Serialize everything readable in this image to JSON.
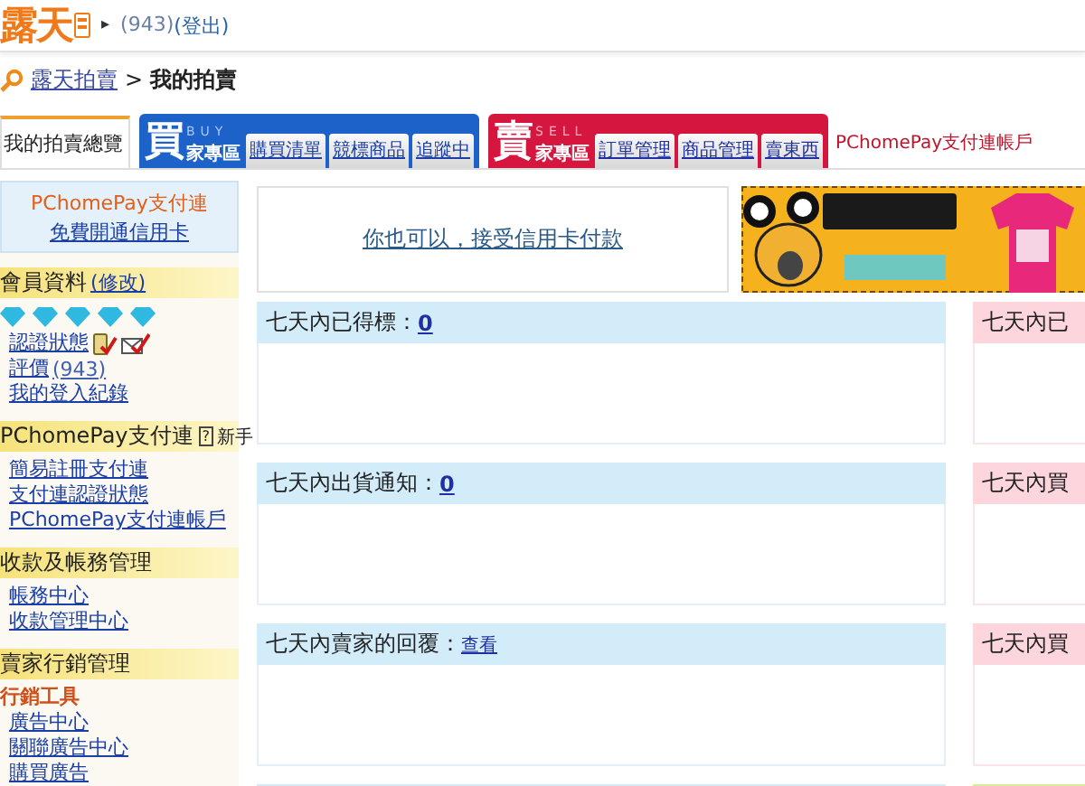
{
  "header": {
    "logo": "露天",
    "arrow": "▸",
    "rating": "(943)",
    "logout": "(登出)"
  },
  "breadcrumb": {
    "home": "露天拍賣",
    "separator": ">",
    "current": "我的拍賣"
  },
  "nav": {
    "overview": {
      "label": "我的拍賣總覽",
      "selected": true
    },
    "sections": [
      {
        "kind": "buy",
        "big": "買",
        "tag": "BUY",
        "label": "家專區",
        "tabs": [
          {
            "label": "購買清單",
            "selected": false
          },
          {
            "label": "競標商品",
            "selected": false
          },
          {
            "label": "追蹤中",
            "selected": false
          }
        ]
      },
      {
        "kind": "sell",
        "big": "賣",
        "tag": "SELL",
        "label": "家專區",
        "tabs": [
          {
            "label": "訂單管理",
            "selected": false
          },
          {
            "label": "商品管理",
            "selected": false
          },
          {
            "label": "賣東西",
            "selected": false
          }
        ]
      }
    ],
    "account_link": "PChomePay支付連帳戶"
  },
  "sidebar": {
    "promo": {
      "title": "PChomePay支付連",
      "link": "免費開通信用卡"
    },
    "sections": [
      {
        "title": "會員資料",
        "edit_link": "(修改)",
        "items": [
          {
            "kind": "diamonds",
            "stars": 5
          },
          {
            "kind": "verify",
            "label": "認證狀態"
          },
          {
            "kind": "count",
            "label": "評價",
            "count": "(943)"
          },
          {
            "kind": "link",
            "label": "我的登入紀錄"
          }
        ]
      },
      {
        "title": "PChomePay支付連",
        "help_icon": "?",
        "help": "新手",
        "items": [
          {
            "kind": "link",
            "label": "簡易註冊支付連"
          },
          {
            "kind": "link",
            "label": "支付連認證狀態"
          },
          {
            "kind": "link",
            "label": "PChomePay支付連帳戶"
          }
        ]
      },
      {
        "title": "收款及帳務管理",
        "items": [
          {
            "kind": "link",
            "label": "帳務中心"
          },
          {
            "kind": "link",
            "label": "收款管理中心"
          }
        ]
      },
      {
        "title": "賣家行銷管理",
        "items": [
          {
            "kind": "subheading",
            "label": "行銷工具"
          },
          {
            "kind": "link",
            "label": "廣告中心"
          },
          {
            "kind": "link",
            "label": "關聯廣告中心"
          },
          {
            "kind": "link",
            "label": "購買廣告"
          }
        ]
      }
    ]
  },
  "main": {
    "promo_link": "你也可以，接受信用卡付款",
    "columns": [
      {
        "panels": [
          {
            "title": "七天內已得標：",
            "value": "0",
            "color": "#d3ecfa"
          },
          {
            "title": "七天內出貨通知：",
            "value": "0",
            "color": "#d3ecfa"
          },
          {
            "title": "七天內賣家的回覆：",
            "value": "查看",
            "color": "#d3ecfa"
          },
          {
            "color": "#d3ecfa"
          }
        ]
      },
      {
        "panels": [
          {
            "title": "七天內已",
            "color": "#fcd5dd"
          },
          {
            "title": "七天內買",
            "color": "#fcd5dd"
          },
          {
            "title": "七天內買",
            "color": "#fcd5dd"
          },
          {
            "color": "#d6ec9a"
          }
        ]
      }
    ]
  }
}
